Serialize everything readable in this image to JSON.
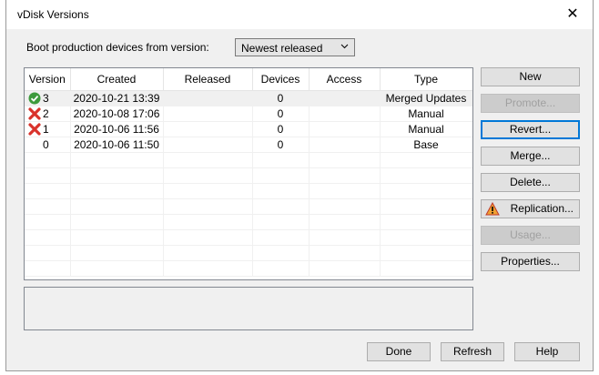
{
  "window": {
    "title": "vDisk Versions",
    "close_label": "✕"
  },
  "boot": {
    "label": "Boot production devices from version:",
    "selected": "Newest released"
  },
  "table": {
    "columns": [
      "Version",
      "Created",
      "Released",
      "Devices",
      "Access",
      "Type"
    ],
    "rows": [
      {
        "status_icon": "check-circle-icon",
        "version": "3",
        "created": "2020-10-21 13:39",
        "released": "",
        "devices": "0",
        "access": "",
        "type": "Merged Updates"
      },
      {
        "status_icon": "red-x-icon",
        "version": "2",
        "created": "2020-10-08 17:06",
        "released": "",
        "devices": "0",
        "access": "",
        "type": "Manual"
      },
      {
        "status_icon": "red-x-icon",
        "version": "1",
        "created": "2020-10-06 11:56",
        "released": "",
        "devices": "0",
        "access": "",
        "type": "Manual"
      },
      {
        "status_icon": "none",
        "version": "0",
        "created": "2020-10-06 11:50",
        "released": "",
        "devices": "0",
        "access": "",
        "type": "Base"
      }
    ]
  },
  "side_buttons": {
    "new": "New",
    "promote": "Promote...",
    "revert": "Revert...",
    "merge": "Merge...",
    "delete": "Delete...",
    "replication": "Replication...",
    "usage": "Usage...",
    "properties": "Properties..."
  },
  "description": "",
  "footer": {
    "done": "Done",
    "refresh": "Refresh",
    "help": "Help"
  },
  "colors": {
    "accent": "#0078d7",
    "check_green": "#3c9a3c",
    "x_red": "#d9322b",
    "warning_orange": "#f0a030"
  }
}
